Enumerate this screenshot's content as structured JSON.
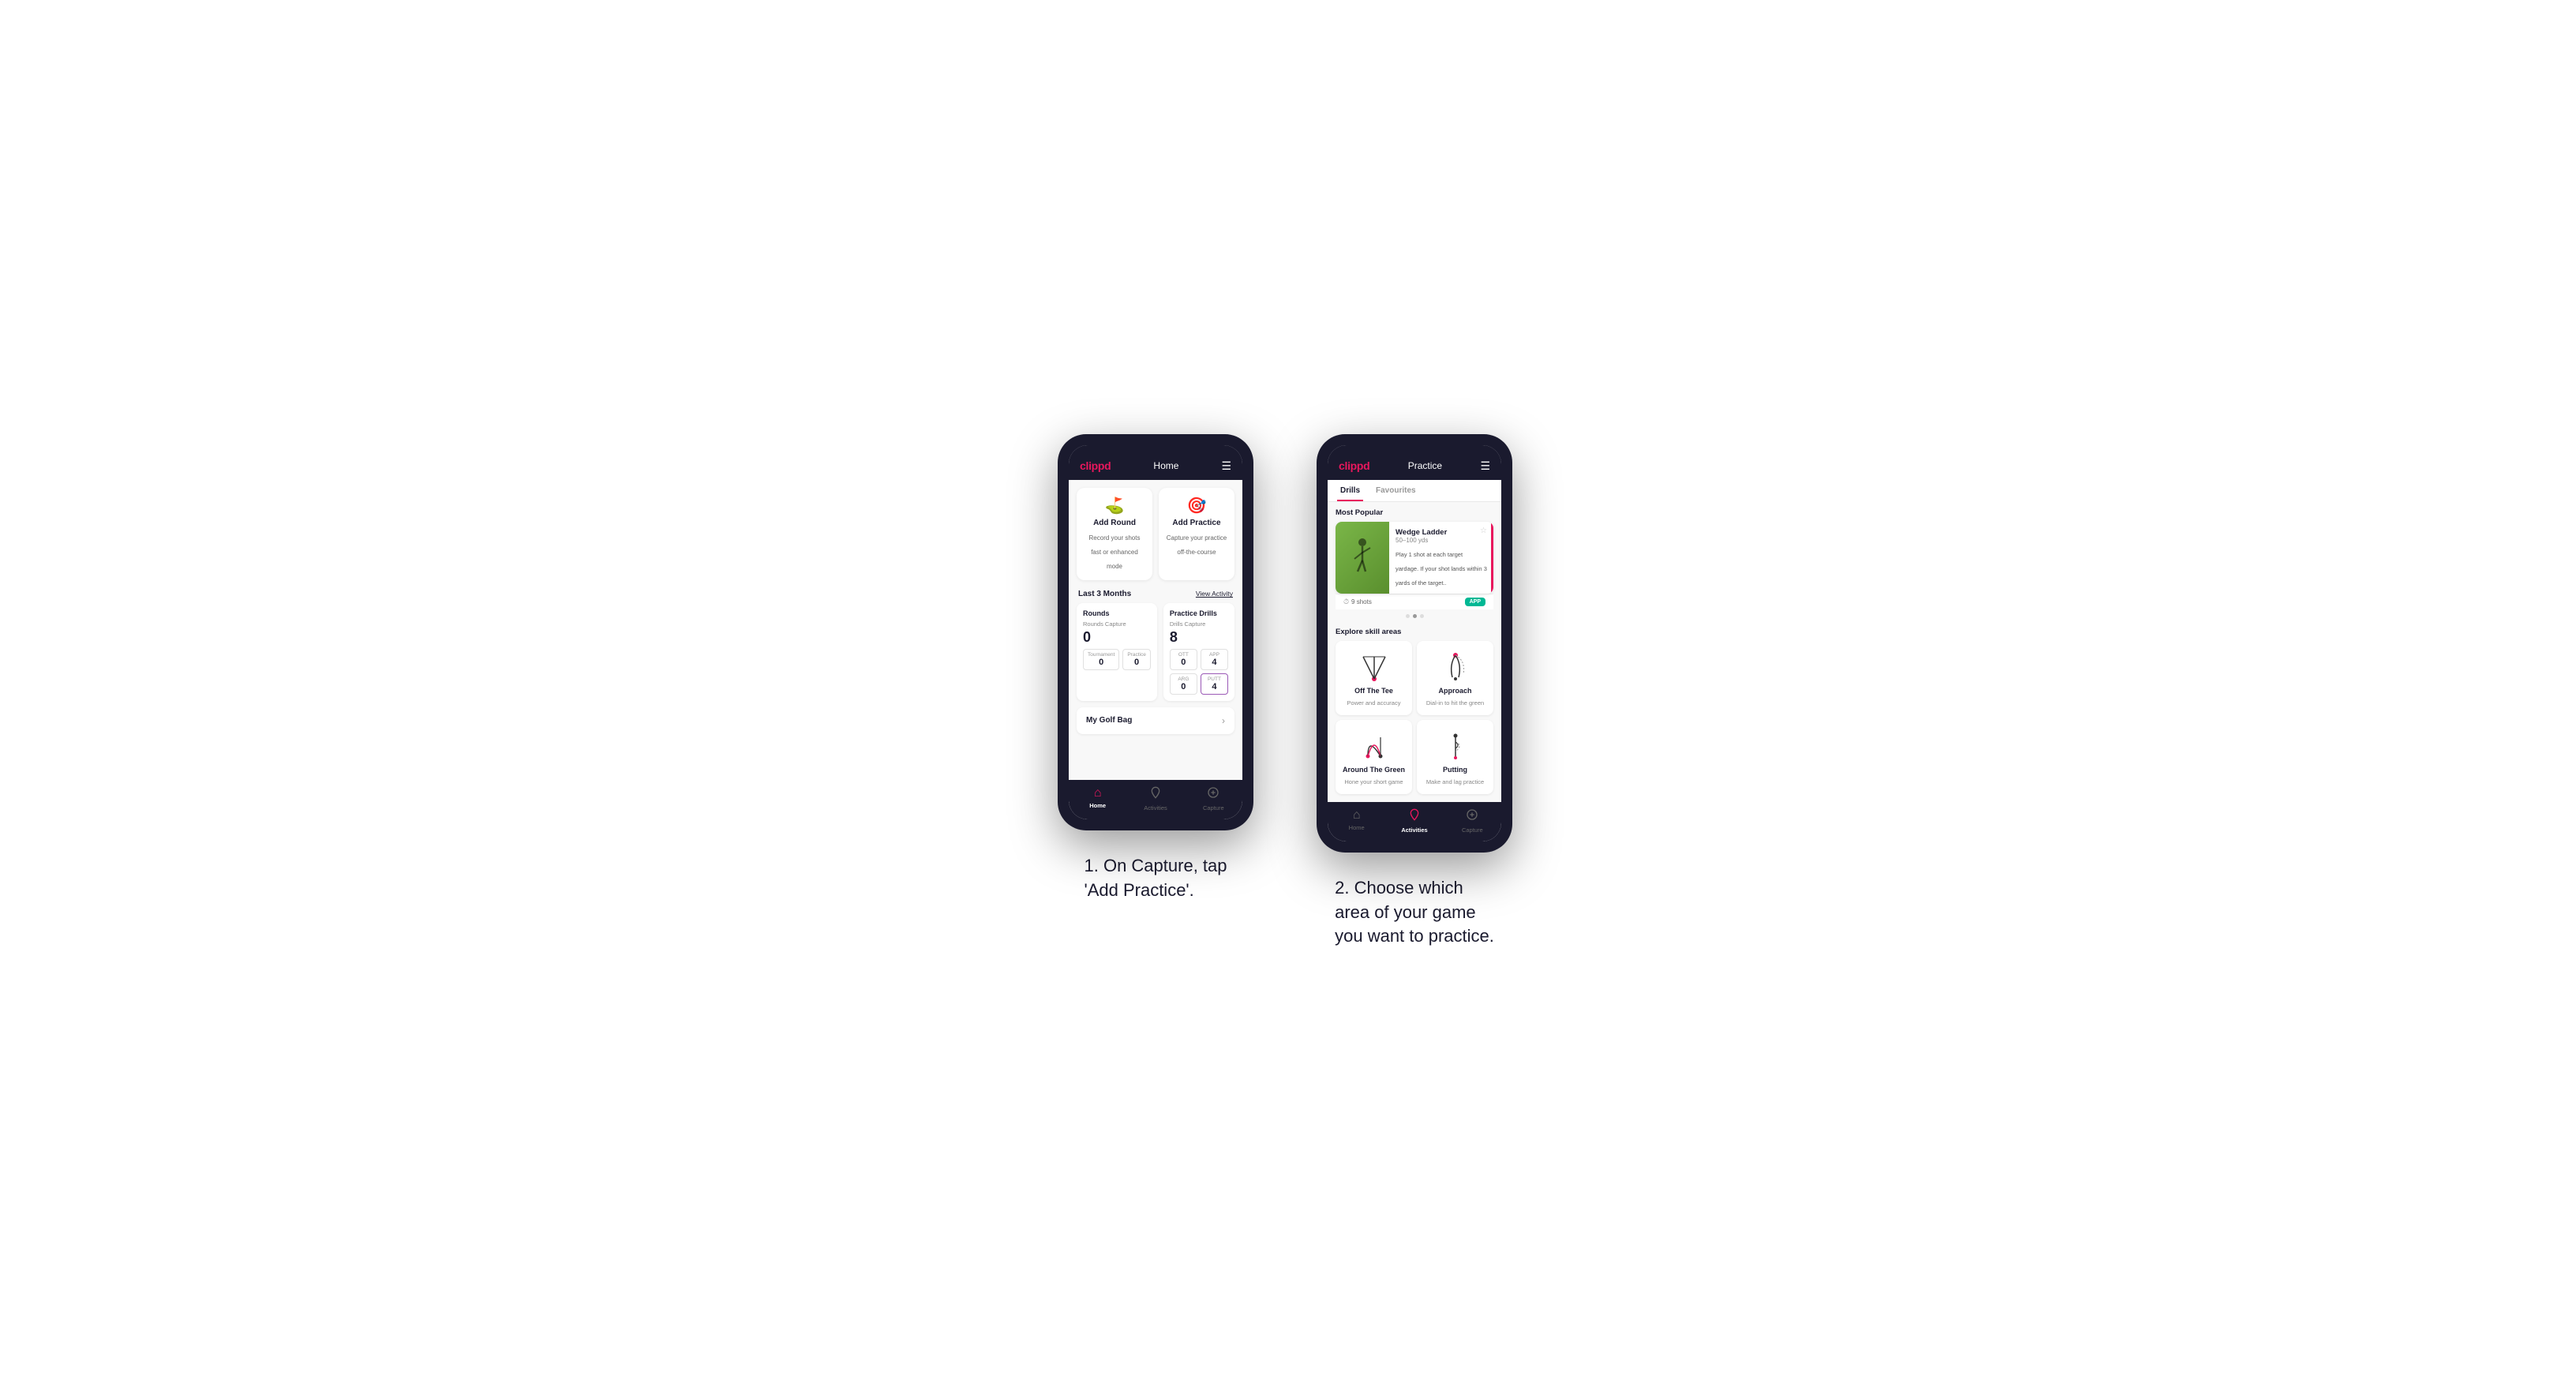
{
  "phone1": {
    "header": {
      "logo": "clippd",
      "title": "Home",
      "menu_icon": "☰"
    },
    "cards": [
      {
        "id": "add-round",
        "icon": "⛳",
        "title": "Add Round",
        "subtitle": "Record your shots fast or enhanced mode"
      },
      {
        "id": "add-practice",
        "icon": "🎯",
        "title": "Add Practice",
        "subtitle": "Capture your practice off-the-course"
      }
    ],
    "last3months": {
      "label": "Last 3 Months",
      "view_activity": "View Activity"
    },
    "rounds": {
      "title": "Rounds",
      "capture_label": "Rounds Capture",
      "capture_value": "0",
      "tournament_label": "Tournament",
      "tournament_value": "0",
      "practice_label": "Practice",
      "practice_value": "0"
    },
    "practice_drills": {
      "title": "Practice Drills",
      "capture_label": "Drills Capture",
      "capture_value": "8",
      "ott_label": "OTT",
      "ott_value": "0",
      "app_label": "APP",
      "app_value": "4",
      "arg_label": "ARG",
      "arg_value": "0",
      "putt_label": "PUTT",
      "putt_value": "4"
    },
    "my_golf_bag": "My Golf Bag",
    "bottom_nav": [
      {
        "icon": "🏠",
        "label": "Home",
        "active": true
      },
      {
        "icon": "📊",
        "label": "Activities",
        "active": false
      },
      {
        "icon": "➕",
        "label": "Capture",
        "active": false
      }
    ]
  },
  "phone2": {
    "header": {
      "logo": "clippd",
      "title": "Practice",
      "menu_icon": "☰"
    },
    "tabs": [
      {
        "label": "Drills",
        "active": true
      },
      {
        "label": "Favourites",
        "active": false
      }
    ],
    "most_popular": {
      "label": "Most Popular",
      "featured": {
        "title": "Wedge Ladder",
        "yardage": "50–100 yds",
        "description": "Play 1 shot at each target yardage. If your shot lands within 3 yards of the target..",
        "shots": "9 shots",
        "badge": "APP"
      },
      "dots": [
        false,
        true,
        false
      ]
    },
    "explore": {
      "label": "Explore skill areas",
      "skills": [
        {
          "id": "off-the-tee",
          "name": "Off The Tee",
          "desc": "Power and accuracy"
        },
        {
          "id": "approach",
          "name": "Approach",
          "desc": "Dial-in to hit the green"
        },
        {
          "id": "around-the-green",
          "name": "Around The Green",
          "desc": "Hone your short game"
        },
        {
          "id": "putting",
          "name": "Putting",
          "desc": "Make and lag practice"
        }
      ]
    },
    "bottom_nav": [
      {
        "icon": "🏠",
        "label": "Home",
        "active": false
      },
      {
        "icon": "📊",
        "label": "Activities",
        "active": true
      },
      {
        "icon": "➕",
        "label": "Capture",
        "active": false
      }
    ]
  },
  "captions": {
    "step1": "1. On Capture, tap\n'Add Practice'.",
    "step2": "2. Choose which\narea of your game\nyou want to practice."
  }
}
